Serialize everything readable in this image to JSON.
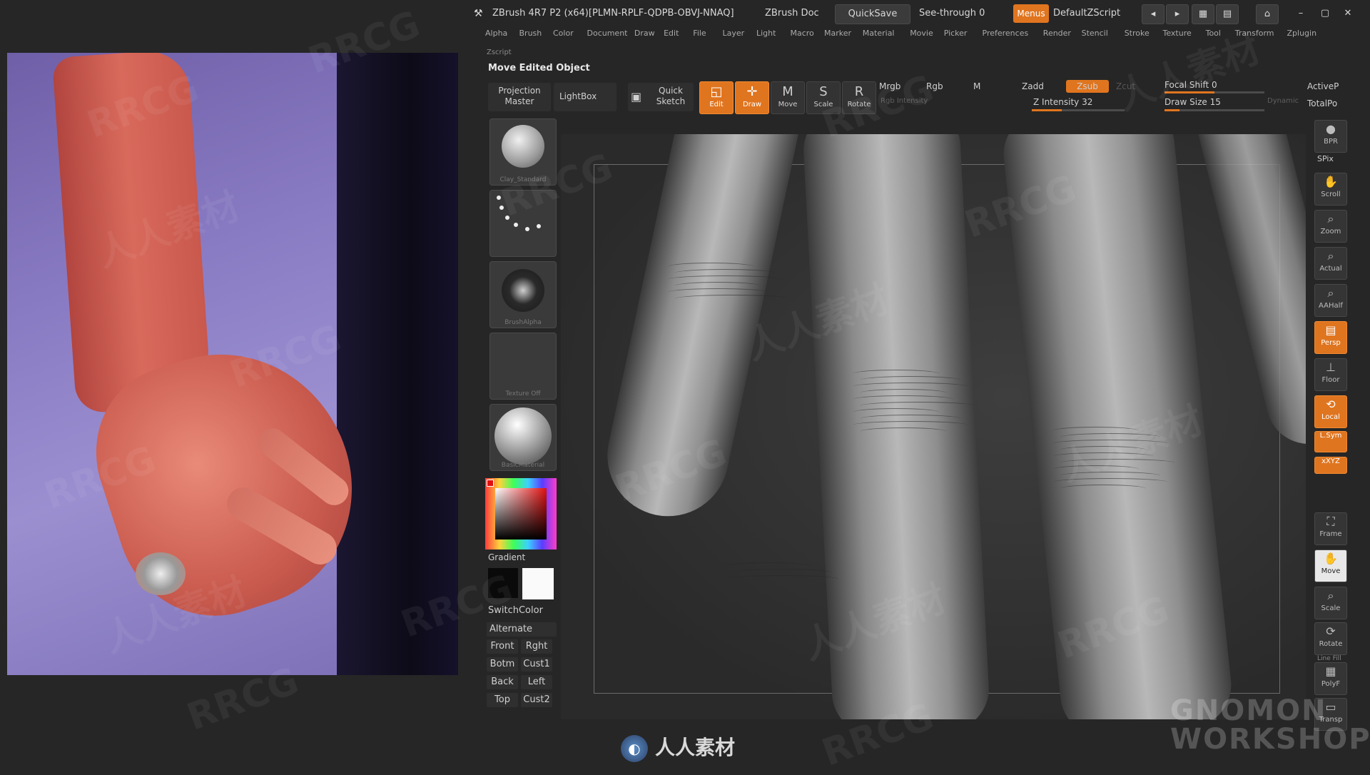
{
  "window": {
    "title": "ZBrush 4R7 P2 (x64)[PLMN-RPLF-QDPB-OBVJ-NNAQ]",
    "doc_label": "ZBrush Doc",
    "quicksave": "QuickSave",
    "see_through": "See-through  0",
    "menus_btn": "Menus",
    "default_zscript": "DefaultZScript"
  },
  "menubar": [
    "Alpha",
    "Brush",
    "Color",
    "Document",
    "Draw",
    "Edit",
    "File",
    "Layer",
    "Light",
    "Macro",
    "Marker",
    "Material",
    "Movie",
    "Picker",
    "Preferences",
    "Render",
    "Stencil",
    "Stroke",
    "Texture",
    "Tool",
    "Transform",
    "Zplugin"
  ],
  "zscript_label": "Zscript",
  "status_text": "Move Edited Object",
  "toolbar": {
    "projection_master": "Projection Master",
    "lightbox": "LightBox",
    "quick_sketch": "Quick Sketch",
    "edit": "Edit",
    "draw": "Draw",
    "move": "Move",
    "scale": "Scale",
    "rotate": "Rotate",
    "mrgb": "Mrgb",
    "rgb": "Rgb",
    "m": "M",
    "rgb_intensity": "Rgb Intensity",
    "zadd": "Zadd",
    "zsub": "Zsub",
    "zcut": "Zcut",
    "z_intensity": "Z Intensity 32",
    "focal_shift": "Focal Shift 0",
    "draw_size": "Draw Size 15",
    "dynamic": "Dynamic",
    "active_points": "ActiveP",
    "total_points": "TotalPo",
    "z_intensity_value": 0.32,
    "focal_shift_value": 0.5,
    "draw_size_value": 0.15
  },
  "left_shelf": {
    "brush_label": "Clay_Standard",
    "stroke_label": "",
    "alpha_label": "BrushAlpha",
    "texture_label": "Texture Off",
    "material_label": "BasicMaterial",
    "gradient": "Gradient",
    "switch_color": "SwitchColor",
    "alternate": "Alternate",
    "views": [
      "Front",
      "Rght",
      "Botm",
      "Cust1",
      "Back",
      "Left",
      "Top",
      "Cust2"
    ]
  },
  "right_shelf": {
    "bpr": "BPR",
    "spix": "SPix",
    "scroll": "Scroll",
    "zoom": "Zoom",
    "actual": "Actual",
    "aahalf": "AAHalf",
    "persp": "Persp",
    "floor": "Floor",
    "local": "Local",
    "lsym": "L.Sym",
    "xyz": "xXYZ",
    "frame": "Frame",
    "move": "Move",
    "scale": "Scale",
    "rotate": "Rotate",
    "polyf": "PolyF",
    "transp": "Transp",
    "line_fill": "Line Fill"
  },
  "watermarks": [
    "RRCG",
    "人人素材"
  ],
  "bottom_logo": "人人素材",
  "gnomon": "GNOMON WORKSHOP",
  "colors": {
    "accent": "#e0751f",
    "bg": "#262626",
    "panel": "#333333"
  }
}
